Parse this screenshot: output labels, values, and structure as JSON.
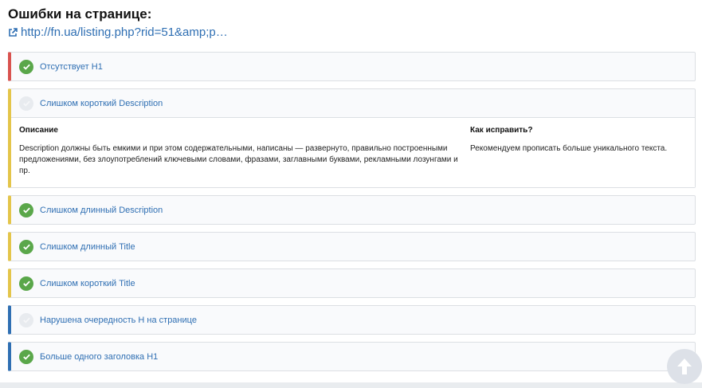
{
  "header": {
    "title": "Ошибки на странице:",
    "url": "http://fn.ua/listing.php?rid=51&amp;p…"
  },
  "items": [
    {
      "label": "Отсутствует H1",
      "status": "ok",
      "accent": "#d9534f"
    },
    {
      "label": "Слишком короткий Description",
      "status": "off",
      "accent": "#e4c54a",
      "expanded": true,
      "details": {
        "description_title": "Описание",
        "description_text": "Description должны быть емкими и при этом содержательными, написаны — развернуто, правильно построенными предложениями, без злоупотреблений ключевыми словами, фразами, заглавными буквами, рекламными лозунгами и пр.",
        "fix_title": "Как исправить?",
        "fix_text": "Рекомендуем прописать больше уникального текста."
      }
    },
    {
      "label": "Слишком длинный Description",
      "status": "ok",
      "accent": "#e4c54a"
    },
    {
      "label": "Слишком длинный Title",
      "status": "ok",
      "accent": "#e4c54a"
    },
    {
      "label": "Слишком короткий Title",
      "status": "ok",
      "accent": "#e4c54a"
    },
    {
      "label": "Нарушена очередность H на странице",
      "status": "off",
      "accent": "#2f6fb3"
    },
    {
      "label": "Больше одного заголовка H1",
      "status": "ok",
      "accent": "#2f6fb3"
    }
  ],
  "icons": {
    "link": "external-link-icon",
    "check": "check-circle-icon",
    "scroll": "arrow-up-icon"
  }
}
